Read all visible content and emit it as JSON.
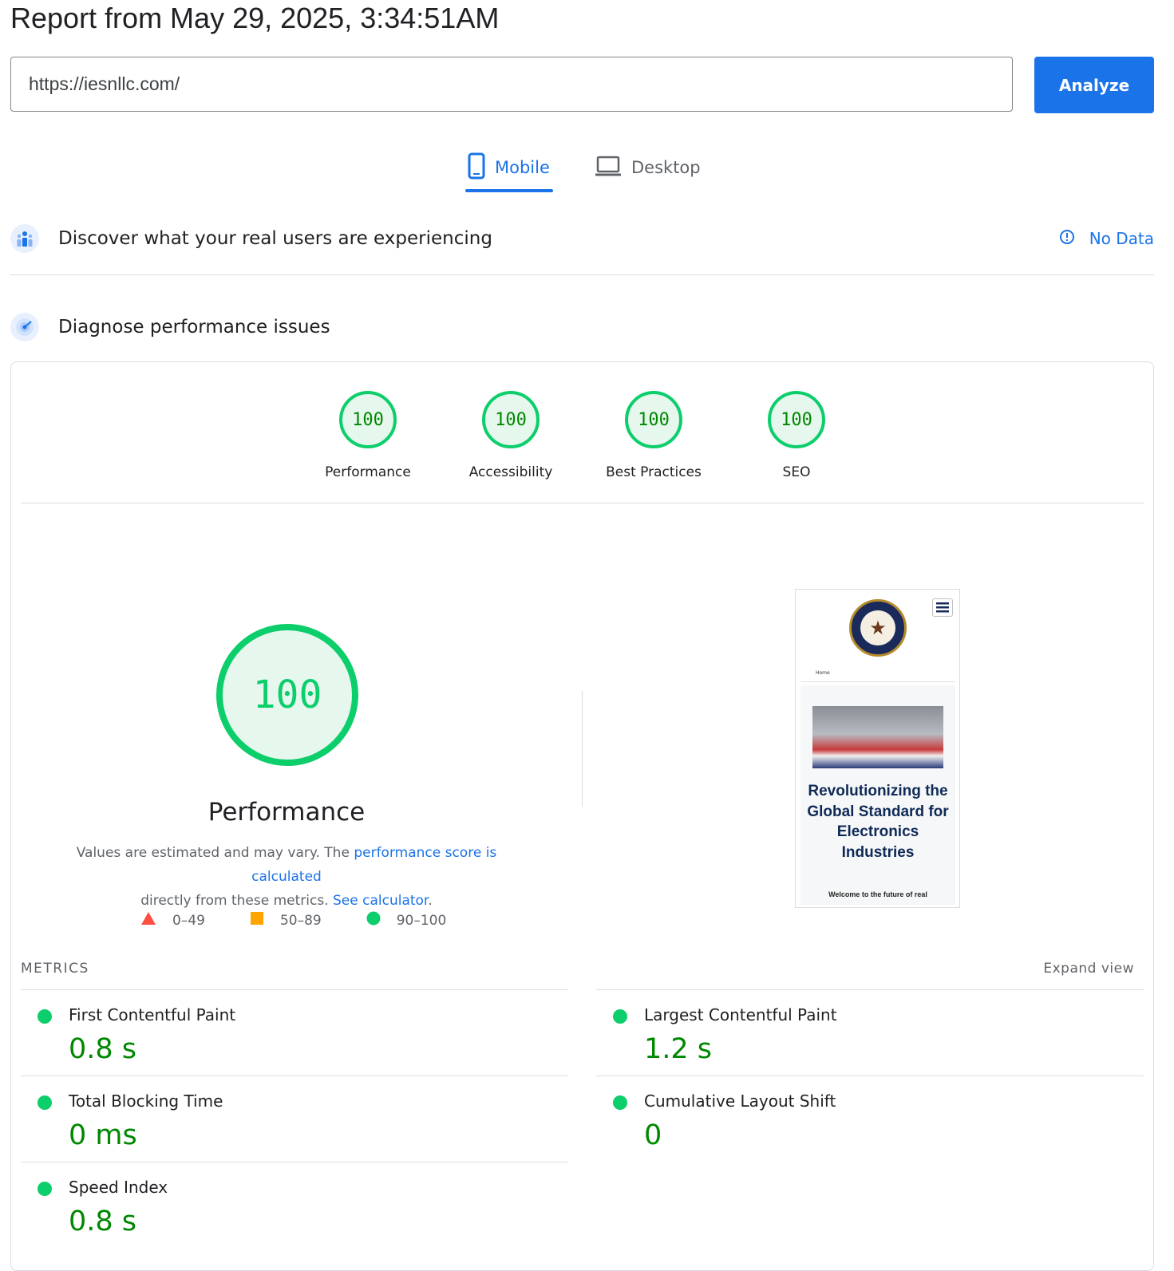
{
  "report": {
    "title": "Report from May 29, 2025, 3:34:51AM"
  },
  "search": {
    "url": "https://iesnllc.com/",
    "button": "Analyze"
  },
  "tabs": {
    "mobile": "Mobile",
    "desktop": "Desktop",
    "active": "Mobile"
  },
  "field_data": {
    "title": "Discover what your real users are experiencing",
    "status": "No Data"
  },
  "lab": {
    "title": "Diagnose performance issues"
  },
  "categories": [
    {
      "score": "100",
      "label": "Performance"
    },
    {
      "score": "100",
      "label": "Accessibility"
    },
    {
      "score": "100",
      "label": "Best Practices"
    },
    {
      "score": "100",
      "label": "SEO"
    }
  ],
  "performance": {
    "score": "100",
    "title": "Performance",
    "desc_1": "Values are estimated and may vary. The ",
    "desc_link_1": "performance score is calculated",
    "desc_2": "directly from these metrics. ",
    "desc_link_2": "See calculator",
    "desc_end": "."
  },
  "legend": {
    "fail": "0–49",
    "average": "50–89",
    "pass": "90–100"
  },
  "screenshot": {
    "nav": "Home",
    "headline": "Revolutionizing the Global Standard for Electronics Industries",
    "welcome": "Welcome to the future of real"
  },
  "metrics": {
    "heading": "METRICS",
    "expand": "Expand view",
    "items": [
      {
        "name": "First Contentful Paint",
        "value": "0.8 s"
      },
      {
        "name": "Largest Contentful Paint",
        "value": "1.2 s"
      },
      {
        "name": "Total Blocking Time",
        "value": "0 ms"
      },
      {
        "name": "Cumulative Layout Shift",
        "value": "0"
      },
      {
        "name": "Speed Index",
        "value": "0.8 s"
      }
    ]
  },
  "colors": {
    "accent": "#1a73e8",
    "pass": "#0cce6b",
    "pass_text": "#008800",
    "average": "#ffa400",
    "fail": "#ff4e42"
  }
}
